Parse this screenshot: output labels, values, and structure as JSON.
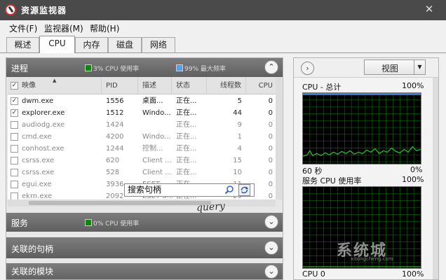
{
  "window": {
    "title": "资源监视器",
    "close": "✕"
  },
  "menu": [
    "文件(F)",
    "监视器(M)",
    "帮助(H)"
  ],
  "tabs": [
    {
      "label": "概述",
      "active": false
    },
    {
      "label": "CPU",
      "active": true
    },
    {
      "label": "内存",
      "active": false
    },
    {
      "label": "磁盘",
      "active": false
    },
    {
      "label": "网络",
      "active": false
    }
  ],
  "process": {
    "title": "进程",
    "legend_usage": "3% CPU 使用率",
    "legend_max": "99% 最大频率",
    "columns": [
      "映像",
      "PID",
      "描述",
      "状态",
      "线程数",
      "CPU"
    ],
    "rows": [
      {
        "checked": true,
        "name": "dwm.exe",
        "pid": "1556",
        "desc": "桌面...",
        "status": "正在...",
        "threads": "5",
        "cpu": "0"
      },
      {
        "checked": true,
        "name": "explorer.exe",
        "pid": "1512",
        "desc": "Windo...",
        "status": "正在...",
        "threads": "44",
        "cpu": "0"
      },
      {
        "checked": false,
        "name": "audiodg.exe",
        "pid": "1424",
        "desc": "",
        "status": "正在...",
        "threads": "9",
        "cpu": "0"
      },
      {
        "checked": false,
        "name": "cmd.exe",
        "pid": "4200",
        "desc": "Windo...",
        "status": "正在...",
        "threads": "1",
        "cpu": "0"
      },
      {
        "checked": false,
        "name": "conhost.exe",
        "pid": "1244",
        "desc": "控制...",
        "status": "正在...",
        "threads": "4",
        "cpu": "0"
      },
      {
        "checked": false,
        "name": "csrss.exe",
        "pid": "620",
        "desc": "Client ...",
        "status": "正在...",
        "threads": "15",
        "cpu": "0"
      },
      {
        "checked": false,
        "name": "csrss.exe",
        "pid": "528",
        "desc": "Client ...",
        "status": "正在...",
        "threads": "10",
        "cpu": "0"
      },
      {
        "checked": false,
        "name": "egui.exe",
        "pid": "3936",
        "desc": "ESET ...",
        "status": "正在...",
        "threads": "11",
        "cpu": "0"
      },
      {
        "checked": false,
        "name": "ekrn.exe",
        "pid": "2092",
        "desc": "ESET S...",
        "status": "正在...",
        "threads": "29",
        "cpu": "0"
      }
    ]
  },
  "services": {
    "title": "服务",
    "legend": "0% CPU 使用率"
  },
  "handles": {
    "title": "关联的句柄",
    "search_placeholder": "搜索句柄",
    "handwriting": "query"
  },
  "modules": {
    "title": "关联的模块"
  },
  "right": {
    "view_label": "视图",
    "cpu_total": {
      "label": "CPU - 总计",
      "max": "100%",
      "time": "60 秒",
      "min": "0%"
    },
    "service_cpu": {
      "label": "服务 CPU 使用率",
      "max": "100%"
    },
    "cpu0": {
      "label": "CPU 0",
      "max": "100%"
    }
  },
  "watermark": {
    "text": "系统城",
    "sub": "xitongcheng.com"
  },
  "colors": {
    "graph_green": "#28c828",
    "grid": "#0a6e0a",
    "usage_swatch": "#0a8a0a",
    "max_swatch": "#5aa0e6"
  }
}
